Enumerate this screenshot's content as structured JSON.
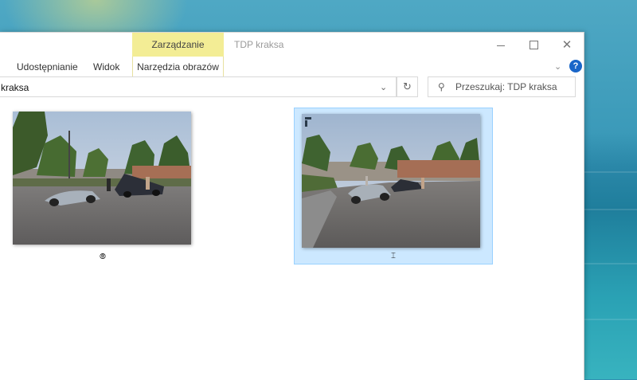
{
  "window": {
    "title": "TDP kraksa",
    "context_tab": "Zarządzanie",
    "controls": {
      "minimize_icon": "minimize-icon",
      "maximize_icon": "maximize-icon",
      "close_glyph": "✕"
    }
  },
  "ribbon": {
    "tabs": [
      {
        "label": "Udostępnianie"
      },
      {
        "label": "Widok"
      },
      {
        "label": "Narzędzia obrazów"
      }
    ],
    "collapse_glyph": "⌄",
    "help_glyph": "?"
  },
  "address": {
    "path": "kraksa",
    "dropdown_glyph": "⌄",
    "refresh_glyph": "↻"
  },
  "search": {
    "placeholder": "Przeszukaj: TDP kraksa",
    "icon_glyph": "⚲"
  },
  "files": [
    {
      "label": "⦾",
      "selected": false
    },
    {
      "label": "⌶",
      "selected": true
    }
  ],
  "colors": {
    "context_tab": "#f3ed95",
    "selection_fill": "#cce8ff",
    "selection_border": "#99d1ff",
    "help_badge": "#1a66c8"
  }
}
